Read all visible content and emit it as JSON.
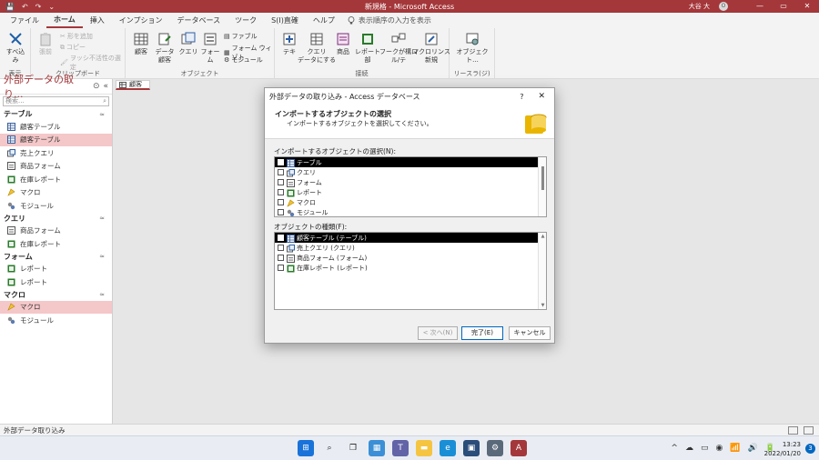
{
  "window": {
    "title": "新規格 - Microsoft Access",
    "user": "大谷 大",
    "avatar": "O",
    "qat": [
      "💾",
      "↶",
      "↷",
      "⌄"
    ],
    "controls": [
      "—",
      "▭",
      "✕"
    ]
  },
  "tabs": [
    "ファイル",
    "ホーム",
    "挿入",
    "インプション",
    "データベース",
    "ツーク",
    "S(I)直確",
    "ヘルプ"
  ],
  "active_tab": "ホーム",
  "tell_me": "表示順序の入力を表示",
  "ribbon": {
    "view_label": "すべ込み",
    "view_group": "表示",
    "paste_label": "張前",
    "clipboard_small": [
      "形を追加",
      "コピー",
      "ヲッシ不活性の選定"
    ],
    "clipboard_group": "クリップボード",
    "object_buttons": [
      "顧客",
      "データ\n顧客",
      "クエリ",
      "フォーム"
    ],
    "object_small": [
      "ファブル",
      "フォーム ウィゾト",
      "モジュール"
    ],
    "object_group": "オブジェクト",
    "link_buttons": [
      "テキ",
      "クエリ\nデータにする",
      "商品",
      "レポート部",
      "フークが構ロ\nル/テ",
      "マクロリンス\n新規"
    ],
    "link_group": "接続",
    "source_button": "オブジェクト...",
    "source_group": "リースラ(ジ)"
  },
  "nav": {
    "title": "外部データの取り...",
    "search_placeholder": "検索...",
    "sections": [
      {
        "name": "テーブル",
        "items": [
          {
            "label": "顧客テーブル",
            "icon": "table-icon"
          },
          {
            "label": "顧客テーブル",
            "icon": "table-icon",
            "selected": true
          },
          {
            "label": "売上クエリ",
            "icon": "query-icon"
          },
          {
            "label": "商品フォーム",
            "icon": "form-icon"
          },
          {
            "label": "在庫レポート",
            "icon": "report-icon"
          },
          {
            "label": "マクロ",
            "icon": "macro-icon"
          },
          {
            "label": "モジュール",
            "icon": "module-icon"
          }
        ]
      },
      {
        "name": "クエリ",
        "items": [
          {
            "label": "商品フォーム",
            "icon": "form-icon"
          },
          {
            "label": "在庫レポート",
            "icon": "report-icon"
          }
        ]
      },
      {
        "name": "フォーム",
        "items": [
          {
            "label": "レポート",
            "icon": "report-icon"
          },
          {
            "label": "レポート",
            "icon": "report-icon"
          }
        ]
      },
      {
        "name": "マクロ",
        "items": [
          {
            "label": "マクロ",
            "icon": "macro-icon",
            "selected": true
          },
          {
            "label": "モジュール",
            "icon": "module-icon"
          }
        ]
      }
    ]
  },
  "doc_tab": "顧客",
  "dialog": {
    "title": "外部データの取り込み - Access データベース",
    "help": "?",
    "close": "✕",
    "header_title": "インポートするオブジェクトの選択",
    "header_sub": "インポートするオブジェクトを選択してください。",
    "select_label": "インポートするオブジェクトの選択(N):",
    "object_types": [
      {
        "label": "テーブル",
        "icon": "table-icon",
        "highlighted": true
      },
      {
        "label": "クエリ",
        "icon": "query-icon"
      },
      {
        "label": "フォーム",
        "icon": "form-icon"
      },
      {
        "label": "レポート",
        "icon": "report-icon"
      },
      {
        "label": "マクロ",
        "icon": "macro-icon"
      },
      {
        "label": "モジュール",
        "icon": "module-icon"
      }
    ],
    "kind_label": "オブジェクトの種類(F):",
    "objects": [
      {
        "label": "顧客テーブル (テーブル)",
        "icon": "table-icon",
        "highlighted": true
      },
      {
        "label": "売上クエリ (クエリ)",
        "icon": "query-icon"
      },
      {
        "label": "商品フォーム (フォーム)",
        "icon": "form-icon"
      },
      {
        "label": "在庫レポート (レポート)",
        "icon": "report-icon"
      }
    ],
    "back_button": "< 次へ(N)",
    "finish_button": "完了(E)",
    "cancel_button": "キャンセル"
  },
  "status": {
    "text": "外部データ取り込み"
  },
  "taskbar": {
    "apps": [
      "windows-icon",
      "search-icon",
      "taskview-icon",
      "widgets-icon",
      "teams-icon",
      "explorer-icon",
      "edge-icon",
      "store-icon",
      "settings-icon",
      "access-icon"
    ],
    "tray": [
      "^",
      "☁",
      "▭",
      "◉",
      "📶",
      "🔊",
      "🔋"
    ],
    "time": "13:23",
    "date": "2022/01/20",
    "notifications": "3"
  },
  "colors": {
    "accent": "#a4373a",
    "selection": "#f4c7c9",
    "highlight": "#000000"
  }
}
